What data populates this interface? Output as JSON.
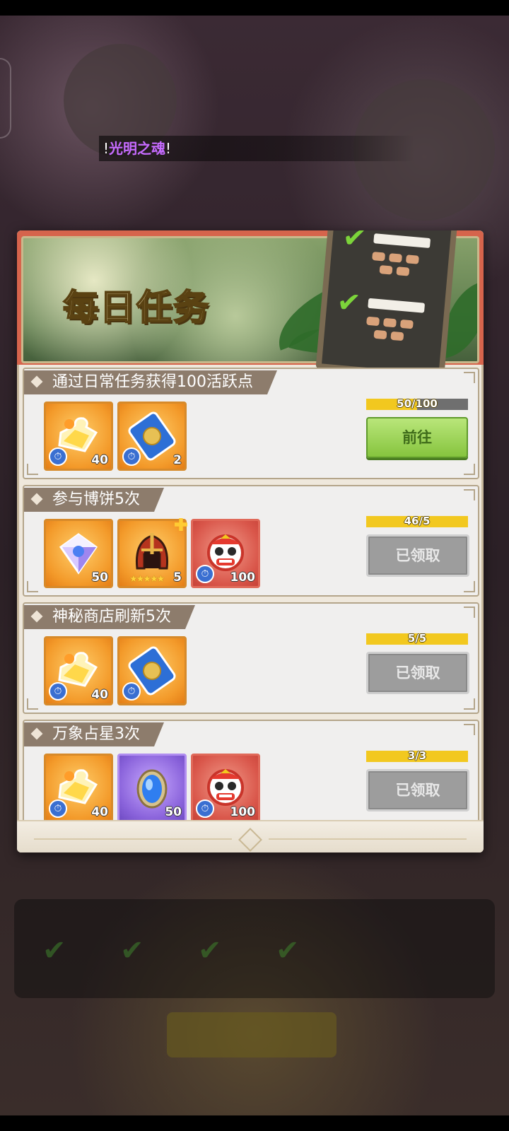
{
  "ticker": {
    "prefix": "!",
    "highlight": "光明之魂",
    "suffix": "!"
  },
  "header": {
    "title": "每日任务"
  },
  "tasks": [
    {
      "title": "通过日常任务获得100活跃点",
      "progress_text": "50/100",
      "progress_fraction": 0.5,
      "button_label": "前往",
      "button_state": "go",
      "rewards": [
        {
          "icon": "puzzle-piece-icon",
          "qty": "40",
          "timed": true
        },
        {
          "icon": "blue-card-icon",
          "qty": "2",
          "timed": true
        }
      ]
    },
    {
      "title": "参与博饼5次",
      "progress_text": "46/5",
      "progress_fraction": 1.0,
      "button_label": "已领取",
      "button_state": "claimed",
      "rewards": [
        {
          "icon": "diamond-icon",
          "qty": "50",
          "timed": false
        },
        {
          "icon": "helmet-icon",
          "qty": "5",
          "timed": false,
          "stars": "★★★★★"
        },
        {
          "icon": "lion-dance-icon",
          "qty": "100",
          "timed": true
        }
      ]
    },
    {
      "title": "神秘商店刷新5次",
      "progress_text": "5/5",
      "progress_fraction": 1.0,
      "button_label": "已领取",
      "button_state": "claimed",
      "rewards": [
        {
          "icon": "puzzle-piece-icon",
          "qty": "40",
          "timed": true
        },
        {
          "icon": "blue-card-icon",
          "qty": "",
          "timed": true
        }
      ]
    },
    {
      "title": "万象占星3次",
      "progress_text": "3/3",
      "progress_fraction": 1.0,
      "button_label": "已领取",
      "button_state": "claimed",
      "rewards": [
        {
          "icon": "puzzle-piece-icon",
          "qty": "40",
          "timed": true
        },
        {
          "icon": "blue-gem-icon",
          "qty": "50",
          "timed": false
        },
        {
          "icon": "lion-dance-icon",
          "qty": "100",
          "timed": true
        }
      ]
    }
  ],
  "colors": {
    "accent_red": "#d6644c",
    "progress_yellow": "#f2c81f",
    "go_green": "#86c43e",
    "claimed_gray": "#9d9d9d"
  }
}
